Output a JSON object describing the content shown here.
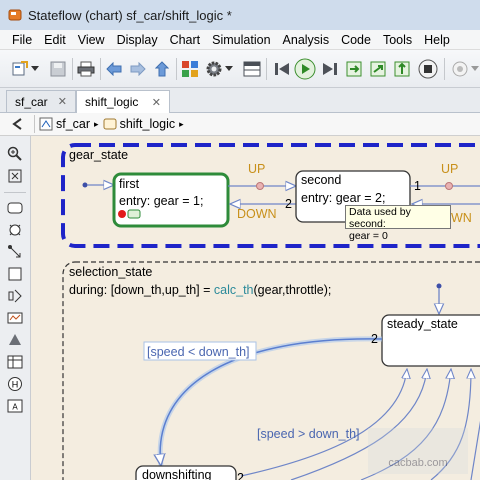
{
  "window": {
    "title": "Stateflow (chart) sf_car/shift_logic *"
  },
  "menu": [
    "File",
    "Edit",
    "View",
    "Display",
    "Chart",
    "Simulation",
    "Analysis",
    "Code",
    "Tools",
    "Help"
  ],
  "tabs": [
    {
      "label": "sf_car",
      "close": "✕"
    },
    {
      "label": "shift_logic",
      "close": "✕"
    }
  ],
  "breadcrumb": {
    "items": [
      "sf_car",
      "shift_logic"
    ],
    "sep": "▸"
  },
  "chart": {
    "gear_state": {
      "label": "gear_state",
      "first": {
        "name": "first",
        "entry": "entry: gear = 1;"
      },
      "second": {
        "name": "second",
        "entry": "entry: gear = 2;"
      },
      "up_label": "UP",
      "down_label": "DOWN",
      "up_label2": "UP",
      "down_label2": "WN",
      "num_1": "1",
      "num_2": "2"
    },
    "selection_state": {
      "label": "selection_state",
      "during_prefix": "during: [down_th,up_th] = ",
      "during_fn": "calc_th",
      "during_args": "(gear,throttle);",
      "steady": "steady_state",
      "downshifting": "downshifting",
      "cond_down": "[speed < down_th]",
      "cond_up": "[speed > down_th]",
      "num_2a": "2",
      "num_2b": "2"
    },
    "tooltip": {
      "line1": "Data used by second:",
      "line2": "gear = 0"
    }
  },
  "colors": {
    "gear_border": "#1e24c8",
    "active_state": "#2e8b3a",
    "transition_blue": "#6f86c8",
    "condition_text": "#4a66b0",
    "transition_label": "#c8901a",
    "canvas_bg": "#f4ede0"
  },
  "watermark": {
    "text": "cacbab.com"
  }
}
